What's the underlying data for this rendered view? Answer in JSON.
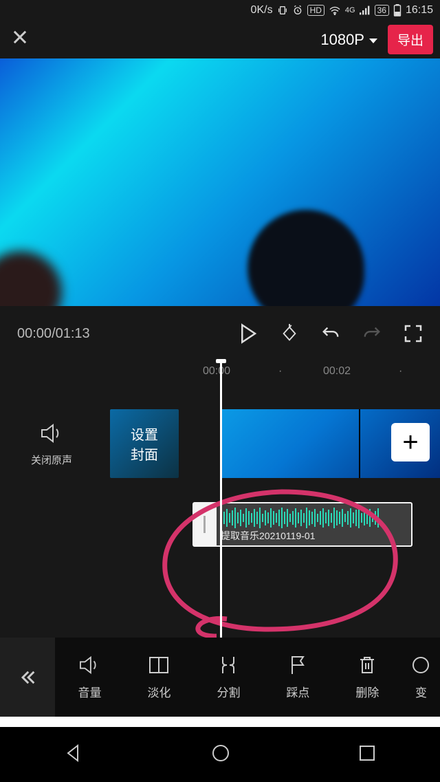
{
  "status": {
    "net_speed": "0K/s",
    "battery": "36",
    "time": "16:15",
    "hd": "HD",
    "net_gen": "4G"
  },
  "topbar": {
    "resolution": "1080P",
    "export": "导出"
  },
  "playback": {
    "current": "00:00",
    "duration": "01:13"
  },
  "ruler": {
    "t0": "00:00",
    "t1": "00:02"
  },
  "mute": {
    "label": "关闭原声"
  },
  "cover": {
    "label": "设置\n封面"
  },
  "audio": {
    "label": "提取音乐20210119-01"
  },
  "tools": {
    "volume": "音量",
    "fade": "淡化",
    "split": "分割",
    "beat": "踩点",
    "delete": "删除",
    "speed": "变"
  }
}
